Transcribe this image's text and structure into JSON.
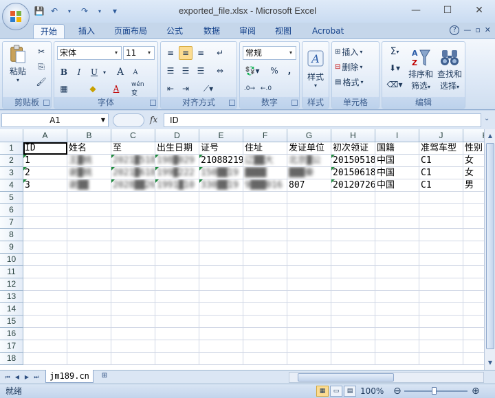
{
  "window": {
    "title": "exported_file.xlsx - Microsoft Excel",
    "controls": {
      "minimize": "—",
      "maximize": "☐",
      "close": "✕"
    }
  },
  "quick_access": {
    "save": "💾",
    "undo": "↶",
    "redo": "↷",
    "customize": "▾"
  },
  "ribbon_tabs": [
    "开始",
    "插入",
    "页面布局",
    "公式",
    "数据",
    "审阅",
    "视图",
    "Acrobat"
  ],
  "ribbon_tab_active": "开始",
  "ribbon_right": {
    "help": "?",
    "min": "—",
    "restore": "▫",
    "close": "✕"
  },
  "ribbon": {
    "clipboard": {
      "label": "剪贴板",
      "paste": "粘贴"
    },
    "font": {
      "label": "字体",
      "family": "宋体",
      "size": "11",
      "bold": "B",
      "italic": "I",
      "underline": "U",
      "grow": "A",
      "shrink": "A",
      "font_color": "A",
      "phonetic": "wén 变"
    },
    "alignment": {
      "label": "对齐方式"
    },
    "number": {
      "label": "数字",
      "format": "常规",
      "percent": "%",
      "comma": ","
    },
    "styles": {
      "label": "样式",
      "button": "样式"
    },
    "cells": {
      "label": "单元格",
      "insert": "插入",
      "delete": "删除",
      "format": "格式"
    },
    "editing": {
      "label": "编辑",
      "sigma": "Σ",
      "sort_filter": "排序和\n筛选",
      "find_select": "查找和\n选择",
      "sort_line1": "排序和",
      "sort_line2": "筛选",
      "find_line1": "查找和",
      "find_line2": "选择"
    }
  },
  "formula_bar": {
    "name_box": "A1",
    "fx": "fx",
    "content": "ID"
  },
  "sheet": {
    "columns": [
      "A",
      "B",
      "C",
      "D",
      "E",
      "F",
      "G",
      "H",
      "I",
      "J",
      "K"
    ],
    "row_numbers": [
      "1",
      "2",
      "3",
      "4",
      "5",
      "6",
      "7",
      "8",
      "9",
      "10",
      "11",
      "12",
      "13",
      "14",
      "15",
      "16",
      "17",
      "18"
    ],
    "rows": [
      [
        "ID",
        "姓名",
        "至",
        "出生日期",
        "证号",
        "住址",
        "发证单位",
        "初次领证",
        "国籍",
        "准驾车型",
        "性别"
      ],
      [
        "1",
        "王▓桃",
        "2021▓518",
        "198▓029",
        "21088219",
        "辽▓▓大",
        "北京▓公",
        "20150518",
        "中国",
        "C1",
        "女"
      ],
      [
        "2",
        "谢▓桃",
        "2021▓618",
        "199▓222",
        "150▓▓19",
        "▓▓▓▓",
        "▓▓▓秦",
        "20150618",
        "中国",
        "C1",
        "女"
      ],
      [
        "3",
        "谢▓▓",
        "2028▓▓26",
        "1991▓10",
        "330▓▓19",
        "9▓▓▓016",
        "807",
        "20120726",
        "中国",
        "C1",
        "男"
      ]
    ]
  },
  "sheet_tabs": {
    "active": "jm189.cn"
  },
  "status": {
    "ready": "就绪",
    "zoom": "100%",
    "zoom_out": "⊖",
    "zoom_in": "⊕"
  }
}
